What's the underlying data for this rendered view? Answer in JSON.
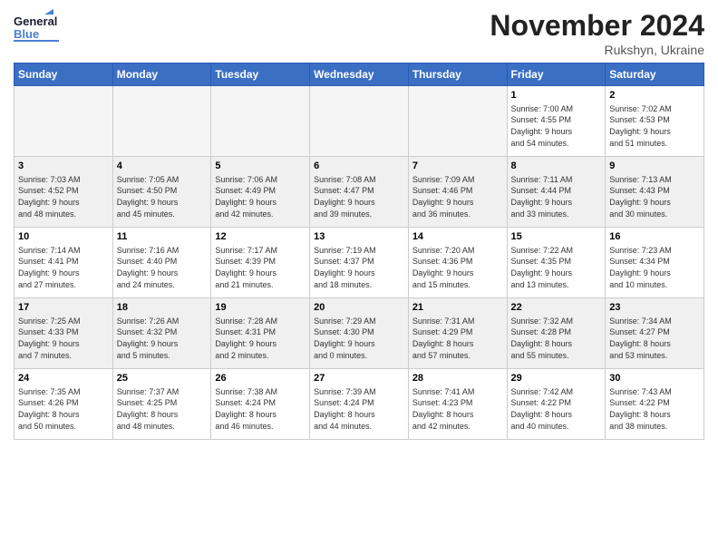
{
  "header": {
    "logo_general": "General",
    "logo_blue": "Blue",
    "month": "November 2024",
    "location": "Rukshyn, Ukraine"
  },
  "weekdays": [
    "Sunday",
    "Monday",
    "Tuesday",
    "Wednesday",
    "Thursday",
    "Friday",
    "Saturday"
  ],
  "weeks": [
    [
      {
        "day": "",
        "info": ""
      },
      {
        "day": "",
        "info": ""
      },
      {
        "day": "",
        "info": ""
      },
      {
        "day": "",
        "info": ""
      },
      {
        "day": "",
        "info": ""
      },
      {
        "day": "1",
        "info": "Sunrise: 7:00 AM\nSunset: 4:55 PM\nDaylight: 9 hours\nand 54 minutes."
      },
      {
        "day": "2",
        "info": "Sunrise: 7:02 AM\nSunset: 4:53 PM\nDaylight: 9 hours\nand 51 minutes."
      }
    ],
    [
      {
        "day": "3",
        "info": "Sunrise: 7:03 AM\nSunset: 4:52 PM\nDaylight: 9 hours\nand 48 minutes."
      },
      {
        "day": "4",
        "info": "Sunrise: 7:05 AM\nSunset: 4:50 PM\nDaylight: 9 hours\nand 45 minutes."
      },
      {
        "day": "5",
        "info": "Sunrise: 7:06 AM\nSunset: 4:49 PM\nDaylight: 9 hours\nand 42 minutes."
      },
      {
        "day": "6",
        "info": "Sunrise: 7:08 AM\nSunset: 4:47 PM\nDaylight: 9 hours\nand 39 minutes."
      },
      {
        "day": "7",
        "info": "Sunrise: 7:09 AM\nSunset: 4:46 PM\nDaylight: 9 hours\nand 36 minutes."
      },
      {
        "day": "8",
        "info": "Sunrise: 7:11 AM\nSunset: 4:44 PM\nDaylight: 9 hours\nand 33 minutes."
      },
      {
        "day": "9",
        "info": "Sunrise: 7:13 AM\nSunset: 4:43 PM\nDaylight: 9 hours\nand 30 minutes."
      }
    ],
    [
      {
        "day": "10",
        "info": "Sunrise: 7:14 AM\nSunset: 4:41 PM\nDaylight: 9 hours\nand 27 minutes."
      },
      {
        "day": "11",
        "info": "Sunrise: 7:16 AM\nSunset: 4:40 PM\nDaylight: 9 hours\nand 24 minutes."
      },
      {
        "day": "12",
        "info": "Sunrise: 7:17 AM\nSunset: 4:39 PM\nDaylight: 9 hours\nand 21 minutes."
      },
      {
        "day": "13",
        "info": "Sunrise: 7:19 AM\nSunset: 4:37 PM\nDaylight: 9 hours\nand 18 minutes."
      },
      {
        "day": "14",
        "info": "Sunrise: 7:20 AM\nSunset: 4:36 PM\nDaylight: 9 hours\nand 15 minutes."
      },
      {
        "day": "15",
        "info": "Sunrise: 7:22 AM\nSunset: 4:35 PM\nDaylight: 9 hours\nand 13 minutes."
      },
      {
        "day": "16",
        "info": "Sunrise: 7:23 AM\nSunset: 4:34 PM\nDaylight: 9 hours\nand 10 minutes."
      }
    ],
    [
      {
        "day": "17",
        "info": "Sunrise: 7:25 AM\nSunset: 4:33 PM\nDaylight: 9 hours\nand 7 minutes."
      },
      {
        "day": "18",
        "info": "Sunrise: 7:26 AM\nSunset: 4:32 PM\nDaylight: 9 hours\nand 5 minutes."
      },
      {
        "day": "19",
        "info": "Sunrise: 7:28 AM\nSunset: 4:31 PM\nDaylight: 9 hours\nand 2 minutes."
      },
      {
        "day": "20",
        "info": "Sunrise: 7:29 AM\nSunset: 4:30 PM\nDaylight: 9 hours\nand 0 minutes."
      },
      {
        "day": "21",
        "info": "Sunrise: 7:31 AM\nSunset: 4:29 PM\nDaylight: 8 hours\nand 57 minutes."
      },
      {
        "day": "22",
        "info": "Sunrise: 7:32 AM\nSunset: 4:28 PM\nDaylight: 8 hours\nand 55 minutes."
      },
      {
        "day": "23",
        "info": "Sunrise: 7:34 AM\nSunset: 4:27 PM\nDaylight: 8 hours\nand 53 minutes."
      }
    ],
    [
      {
        "day": "24",
        "info": "Sunrise: 7:35 AM\nSunset: 4:26 PM\nDaylight: 8 hours\nand 50 minutes."
      },
      {
        "day": "25",
        "info": "Sunrise: 7:37 AM\nSunset: 4:25 PM\nDaylight: 8 hours\nand 48 minutes."
      },
      {
        "day": "26",
        "info": "Sunrise: 7:38 AM\nSunset: 4:24 PM\nDaylight: 8 hours\nand 46 minutes."
      },
      {
        "day": "27",
        "info": "Sunrise: 7:39 AM\nSunset: 4:24 PM\nDaylight: 8 hours\nand 44 minutes."
      },
      {
        "day": "28",
        "info": "Sunrise: 7:41 AM\nSunset: 4:23 PM\nDaylight: 8 hours\nand 42 minutes."
      },
      {
        "day": "29",
        "info": "Sunrise: 7:42 AM\nSunset: 4:22 PM\nDaylight: 8 hours\nand 40 minutes."
      },
      {
        "day": "30",
        "info": "Sunrise: 7:43 AM\nSunset: 4:22 PM\nDaylight: 8 hours\nand 38 minutes."
      }
    ]
  ]
}
